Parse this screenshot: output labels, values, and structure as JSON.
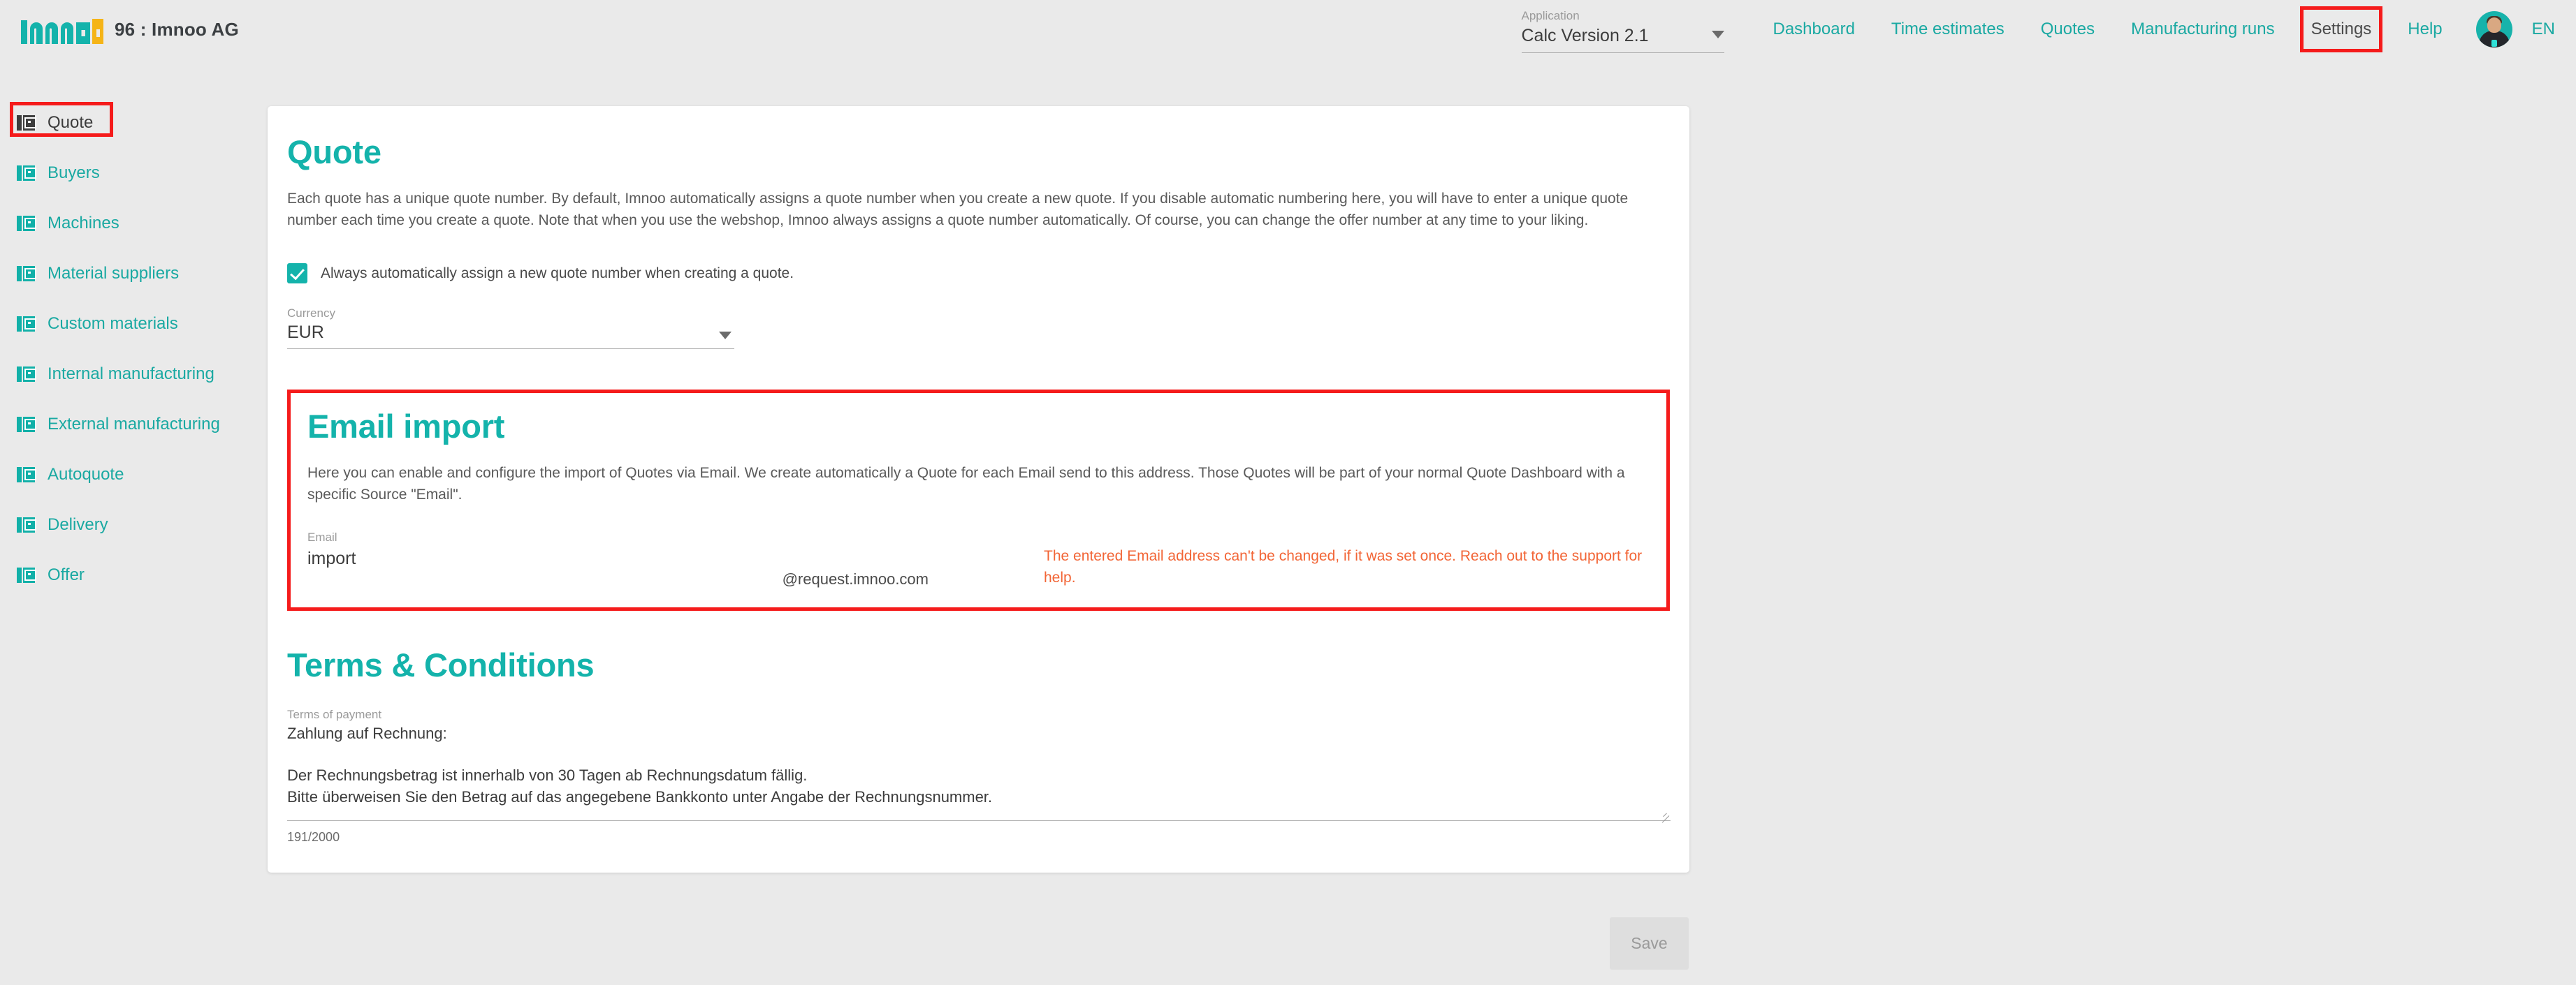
{
  "brand": {
    "logo_text": "imnoo",
    "account": "96 : Imnoo AG"
  },
  "topnav": {
    "application_label": "Application",
    "application_value": "Calc Version 2.1",
    "links": [
      {
        "label": "Dashboard",
        "active": false
      },
      {
        "label": "Time estimates",
        "active": false
      },
      {
        "label": "Quotes",
        "active": false
      },
      {
        "label": "Manufacturing runs",
        "active": false
      },
      {
        "label": "Settings",
        "active": true
      },
      {
        "label": "Help",
        "active": false
      }
    ],
    "language": "EN",
    "avatar_name": "user-avatar"
  },
  "sidebar": {
    "items": [
      {
        "label": "Quote",
        "active": true
      },
      {
        "label": "Buyers",
        "active": false
      },
      {
        "label": "Machines",
        "active": false
      },
      {
        "label": "Material suppliers",
        "active": false
      },
      {
        "label": "Custom materials",
        "active": false
      },
      {
        "label": "Internal manufacturing",
        "active": false
      },
      {
        "label": "External manufacturing",
        "active": false
      },
      {
        "label": "Autoquote",
        "active": false
      },
      {
        "label": "Delivery",
        "active": false
      },
      {
        "label": "Offer",
        "active": false
      }
    ]
  },
  "quote_section": {
    "title": "Quote",
    "description": "Each quote has a unique quote number. By default, Imnoo automatically assigns a quote number when you create a new quote. If you disable automatic numbering here, you will have to enter a unique quote number each time you create a quote. Note that when you use the webshop, Imnoo always assigns a quote number automatically. Of course, you can change the offer number at any time to your liking.",
    "checkbox_label": "Always automatically assign a new quote number when creating a quote.",
    "checkbox_checked": true,
    "currency_label": "Currency",
    "currency_value": "EUR"
  },
  "email_import": {
    "title": "Email import",
    "description": "Here you can enable and configure the import of Quotes via Email. We create automatically a Quote for each Email send to this address. Those Quotes will be part of your normal Quote Dashboard with a specific Source \"Email\".",
    "email_label": "Email",
    "email_value": "import",
    "email_domain": "@request.imnoo.com",
    "warning": "The entered Email address can't be changed, if it was set once. Reach out to the support for help."
  },
  "terms": {
    "title": "Terms & Conditions",
    "field_label": "Terms of payment",
    "lines": [
      "Zahlung auf Rechnung:",
      "",
      "Der Rechnungsbetrag ist innerhalb von 30 Tagen ab Rechnungsdatum fällig.",
      "Bitte überweisen Sie den Betrag auf das angegebene Bankkonto unter Angabe der Rechnungsnummer."
    ],
    "char_count": "191/2000"
  },
  "footer": {
    "save_label": "Save",
    "save_disabled": true
  },
  "colors": {
    "brand_teal": "#14b3ab",
    "brand_yellow": "#f5b417",
    "annotation_red": "#f51b1b",
    "warning_orange": "#f26536",
    "page_background": "#eaeaea",
    "card_background": "#ffffff"
  }
}
